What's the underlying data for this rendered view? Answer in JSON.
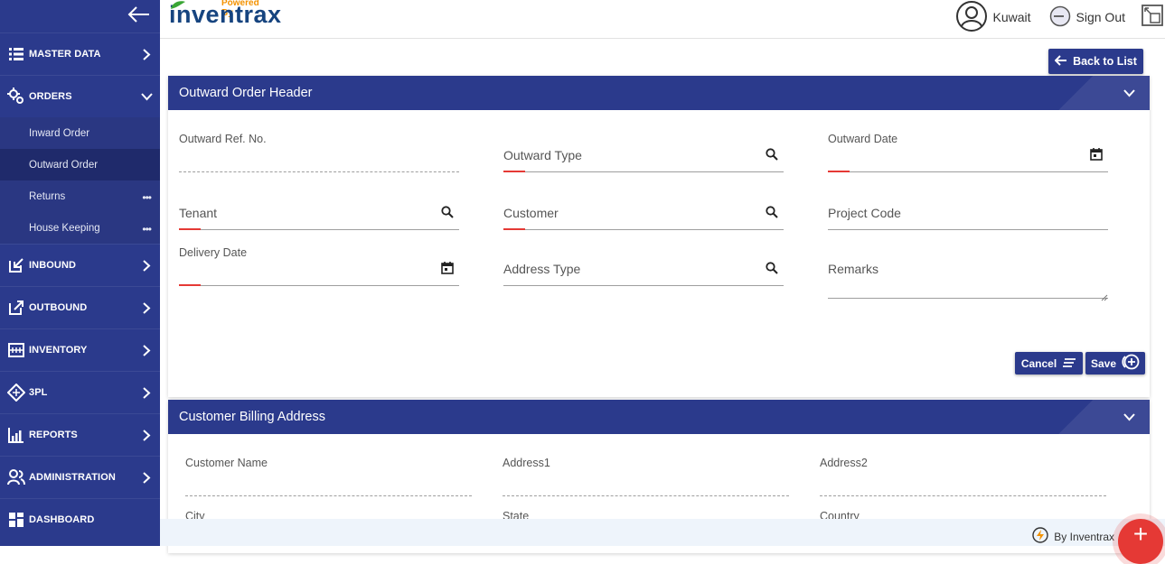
{
  "brand": {
    "powered_by": "Powered By",
    "name": "inventrax"
  },
  "header": {
    "user": "Kuwait",
    "sign_out": "Sign Out"
  },
  "sidebar": {
    "items": [
      {
        "label": "MASTER DATA"
      },
      {
        "label": "ORDERS"
      },
      {
        "label": "INBOUND"
      },
      {
        "label": "OUTBOUND"
      },
      {
        "label": "INVENTORY"
      },
      {
        "label": "3PL"
      },
      {
        "label": "REPORTS"
      },
      {
        "label": "ADMINISTRATION"
      },
      {
        "label": "DASHBOARD"
      }
    ],
    "orders_sub": [
      {
        "label": "Inward Order"
      },
      {
        "label": "Outward Order"
      },
      {
        "label": "Returns"
      },
      {
        "label": "House Keeping"
      }
    ]
  },
  "main": {
    "back_label": "Back to List",
    "header_panel": {
      "title": "Outward Order Header",
      "fields": {
        "outward_ref_no": "Outward Ref. No.",
        "outward_type": "Outward Type",
        "outward_date": "Outward Date",
        "tenant": "Tenant",
        "customer": "Customer",
        "project_code": "Project Code",
        "delivery_date": "Delivery Date",
        "address_type": "Address Type",
        "remarks": "Remarks"
      },
      "cancel_label": "Cancel",
      "save_label": "Save"
    },
    "billing_panel": {
      "title": "Customer Billing Address",
      "fields": {
        "customer_name": "Customer Name",
        "address1": "Address1",
        "address2": "Address2",
        "city": "City",
        "state": "State",
        "country": "Country"
      }
    }
  },
  "footer": {
    "by": "By Inventrax"
  },
  "colors": {
    "primary": "#2b3a8c",
    "accent": "#e53935",
    "brand_orange": "#f39200"
  }
}
